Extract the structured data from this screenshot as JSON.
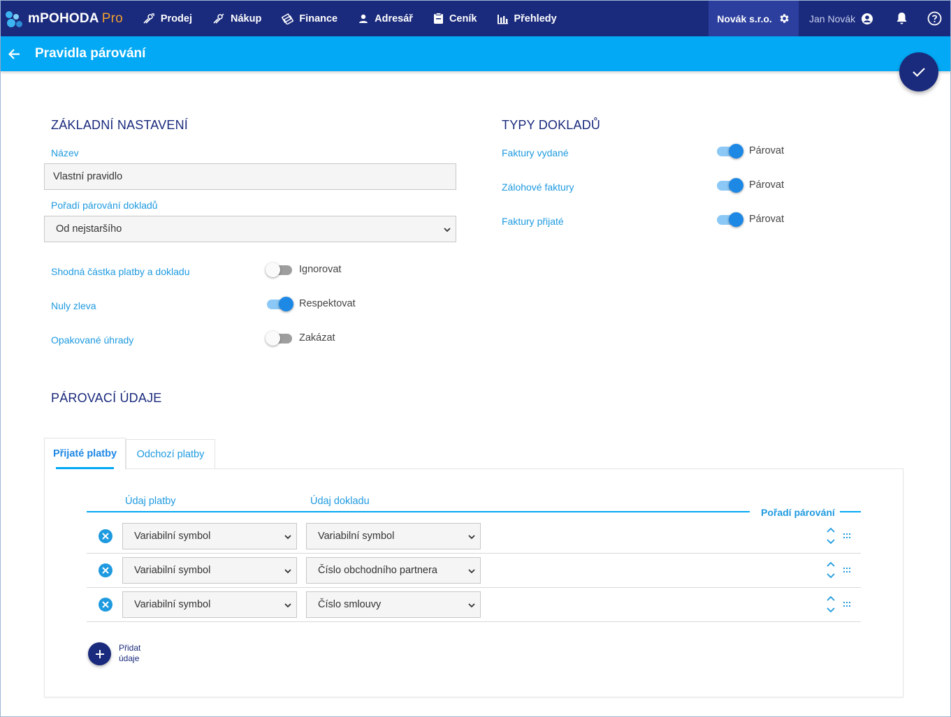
{
  "app": {
    "name": "mPOHODA",
    "edition": "Pro"
  },
  "nav": [
    {
      "label": "Prodej",
      "icon": "hand-coins-icon"
    },
    {
      "label": "Nákup",
      "icon": "hand-coins-icon"
    },
    {
      "label": "Finance",
      "icon": "money-stack-icon"
    },
    {
      "label": "Adresář",
      "icon": "person-icon"
    },
    {
      "label": "Ceník",
      "icon": "clipboard-icon"
    },
    {
      "label": "Přehledy",
      "icon": "bar-chart-icon"
    }
  ],
  "company": "Novák s.r.o.",
  "user": "Jan Novák",
  "page": {
    "title": "Pravidla párování"
  },
  "basic": {
    "title": "ZÁKLADNÍ NASTAVENÍ",
    "name_label": "Název",
    "name_value": "Vlastní pravidlo",
    "order_label": "Pořadí párování dokladů",
    "order_value": "Od nejstaršího",
    "toggles": [
      {
        "label": "Shodná částka platby a dokladu",
        "state": "Ignorovat",
        "on": false
      },
      {
        "label": "Nuly zleva",
        "state": "Respektovat",
        "on": true
      },
      {
        "label": "Opakované úhrady",
        "state": "Zakázat",
        "on": false
      }
    ]
  },
  "doc_types": {
    "title": "TYPY DOKLADŮ",
    "items": [
      {
        "label": "Faktury vydané",
        "state": "Párovat",
        "on": true
      },
      {
        "label": "Zálohové faktury",
        "state": "Párovat",
        "on": true
      },
      {
        "label": "Faktury přijaté",
        "state": "Párovat",
        "on": true
      }
    ]
  },
  "matching": {
    "title": "PÁROVACÍ ÚDAJE",
    "tabs": [
      {
        "label": "Přijaté platby",
        "active": true
      },
      {
        "label": "Odchozí platby",
        "active": false
      }
    ],
    "columns": {
      "payment": "Údaj platby",
      "document": "Údaj dokladu",
      "order": "Pořadí párování"
    },
    "rows": [
      {
        "payment": "Variabilní symbol",
        "document": "Variabilní symbol"
      },
      {
        "payment": "Variabilní symbol",
        "document": "Číslo obchodního partnera"
      },
      {
        "payment": "Variabilní symbol",
        "document": "Číslo smlouvy"
      }
    ],
    "add_label": "Přidat údaje"
  },
  "colors": {
    "navy": "#1a2a7c",
    "accent": "#03a9f4",
    "link": "#1e9ae0",
    "toggle_on": "#1e88e5",
    "remove": "#1e9ae0"
  }
}
